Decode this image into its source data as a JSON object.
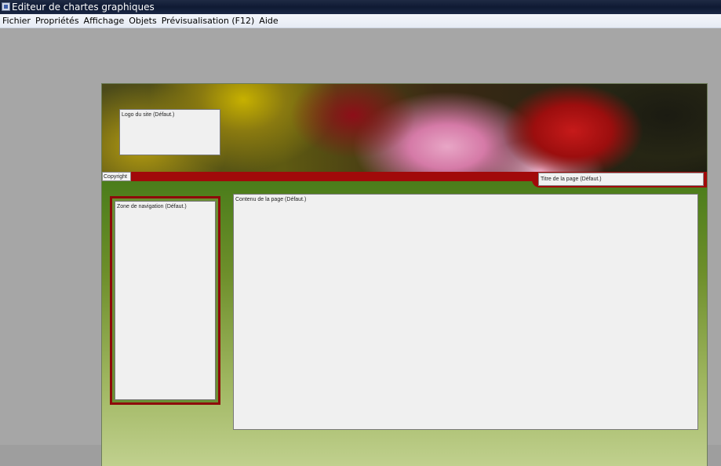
{
  "window": {
    "title": "Editeur de chartes graphiques"
  },
  "menu": {
    "items": [
      "Fichier",
      "Propriétés",
      "Affichage",
      "Objets",
      "Prévisualisation (F12)",
      "Aide"
    ]
  },
  "template": {
    "logo_label": "Logo du site (Défaut.)",
    "copyright_label": "Copyright",
    "page_title_label": "Titre de la page (Défaut.)",
    "navigation_label": "Zone de navigation (Défaut.)",
    "content_label": "Contenu de la page (Défaut.)"
  },
  "colors": {
    "accent_red": "#a10a0a",
    "background_green_top": "#3b6b12",
    "background_green_bottom": "#c0d08e",
    "workspace_gray": "#a6a6a6"
  }
}
